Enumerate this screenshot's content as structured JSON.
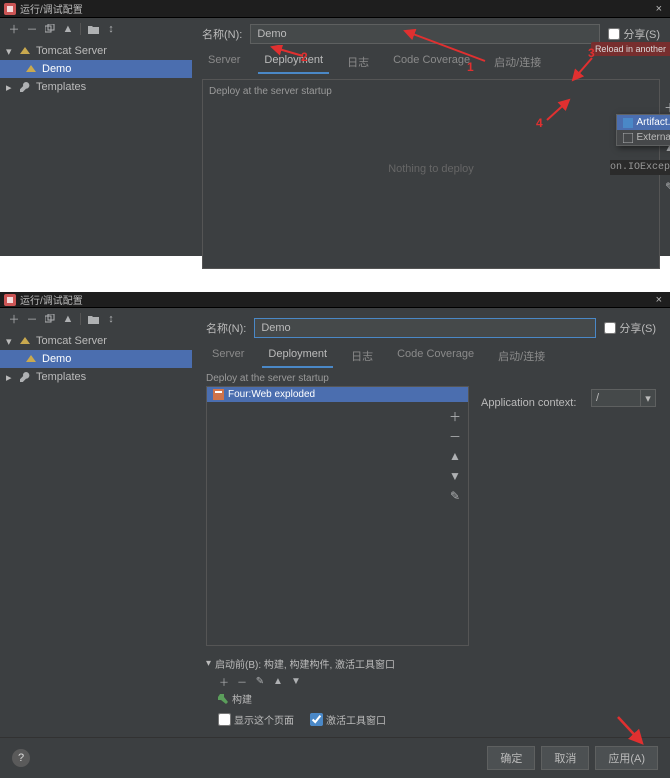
{
  "top": {
    "window_title": "运行/调试配置",
    "toolbar_icons": [
      "plus",
      "minus",
      "copy",
      "up",
      "folder",
      "wand"
    ],
    "tree": {
      "tomcat_label": "Tomcat Server",
      "demo_label": "Demo",
      "templates_label": "Templates"
    },
    "name_label": "名称(N):",
    "name_value": "Demo",
    "share_label": "分享(S)",
    "tabs": [
      "Server",
      "Deployment",
      "日志",
      "Code Coverage",
      "启动/连接"
    ],
    "active_tab": 1,
    "deploy_caption": "Deploy at the server startup",
    "deploy_empty": "Nothing to deploy",
    "popup": {
      "artifact": "Artifact...",
      "external": "External Source..."
    },
    "reload_text": "Reload in another",
    "code_text": "on.IOExcep",
    "callouts": {
      "c1": "1",
      "c2": "2",
      "c3": "3",
      "c4": "4"
    }
  },
  "bottom": {
    "window_title": "运行/调试配置",
    "name_label": "名称(N):",
    "name_value": "Demo",
    "share_label": "分享(S)",
    "tabs": [
      "Server",
      "Deployment",
      "日志",
      "Code Coverage",
      "启动/连接"
    ],
    "active_tab": 1,
    "deploy_caption": "Deploy at the server startup",
    "artifact_name": "Four:Web exploded",
    "context_label": "Application context:",
    "context_value": "/",
    "before_launch": {
      "header": "启动前(B): 构建, 构建构件, 激活工具窗口",
      "build_label": "构建",
      "check_show": "显示这个页面",
      "check_activate": "激活工具窗口"
    },
    "buttons": {
      "ok": "确定",
      "cancel": "取消",
      "apply": "应用(A)"
    },
    "help": "?"
  }
}
